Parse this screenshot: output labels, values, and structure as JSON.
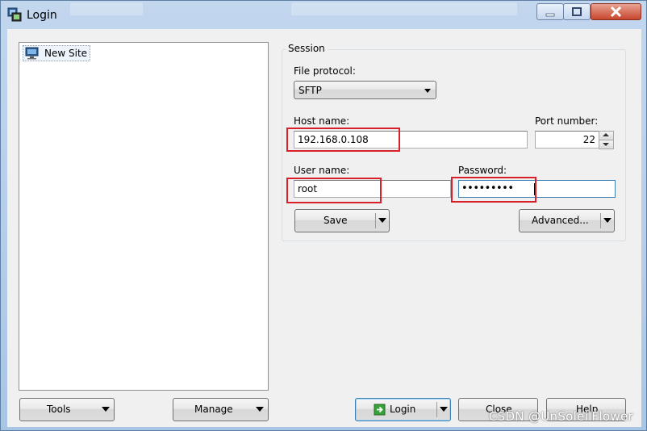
{
  "window": {
    "title": "Login"
  },
  "tree": {
    "items": [
      {
        "label": "New Site"
      }
    ]
  },
  "session": {
    "group_label": "Session",
    "file_protocol_label": "File protocol:",
    "file_protocol_value": "SFTP",
    "host_label": "Host name:",
    "host_value": "192.168.0.108",
    "port_label": "Port number:",
    "port_value": "22",
    "user_label": "User name:",
    "user_value": "root",
    "password_label": "Password:",
    "password_value": "•••••••••",
    "save_label": "Save",
    "advanced_label": "Advanced..."
  },
  "bottom": {
    "tools_label": "Tools",
    "manage_label": "Manage",
    "login_label": "Login",
    "close_label": "Close",
    "help_label": "Help"
  },
  "watermark": "CSDN @UnSoleilFlower",
  "colors": {
    "highlight": "#d9202a",
    "accent": "#3c7fb1"
  }
}
